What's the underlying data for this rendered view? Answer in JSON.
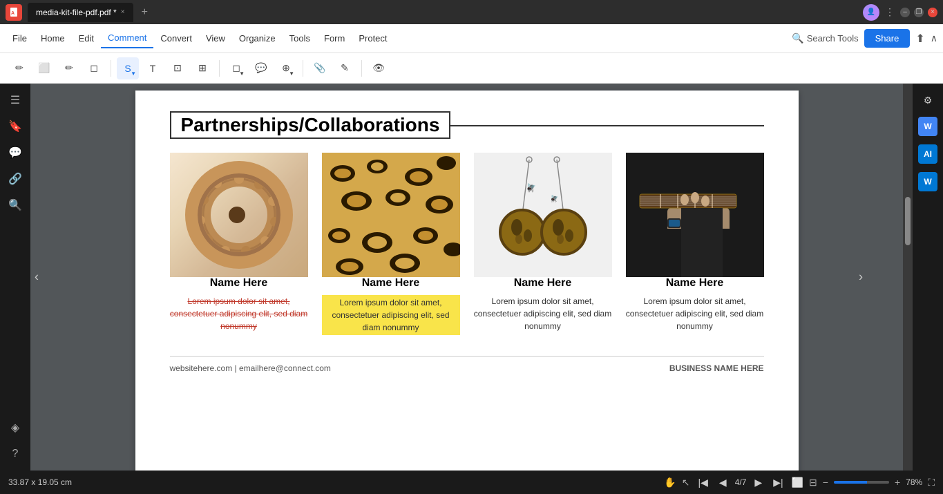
{
  "titlebar": {
    "app_icon": "A",
    "tab_label": "media-kit-file-pdf.pdf *",
    "tab_close": "×",
    "add_tab": "+",
    "window_minimize": "–",
    "window_restore": "❐",
    "window_close": "×"
  },
  "menubar": {
    "file": "File",
    "home": "Home",
    "edit": "Edit",
    "comment": "Comment",
    "convert": "Convert",
    "view": "View",
    "organize": "Organize",
    "tools": "Tools",
    "form": "Form",
    "protect": "Protect",
    "search_tools": "Search Tools",
    "share": "Share"
  },
  "sidebar_left": {
    "icons": [
      "☰",
      "🔖",
      "💬",
      "🔗",
      "🔍",
      "◈"
    ]
  },
  "pdf": {
    "heading": "Partnerships/Collaborations",
    "partners": [
      {
        "name": "Name Here",
        "desc": "Lorem ipsum dolor sit amet, consectetuer adipiscing elit, sed diam nonummy",
        "style": "strikethrough"
      },
      {
        "name": "Name Here",
        "desc": "Lorem ipsum dolor sit amet, consectetuer adipiscing elit, sed diam nonummy",
        "style": "highlighted"
      },
      {
        "name": "Name Here",
        "desc": "Lorem ipsum dolor sit amet, consectetuer adipiscing elit, sed diam nonummy",
        "style": "normal"
      },
      {
        "name": "Name Here",
        "desc": "Lorem ipsum dolor sit amet, consectetuer adipiscing elit, sed diam nonummy",
        "style": "normal"
      }
    ],
    "footer_left": "websitehere.com  |  emailhere@connect.com",
    "footer_right": "BUSINESS NAME HERE",
    "page_current": "4",
    "page_total": "7"
  },
  "bottombar": {
    "dimensions": "33.87 x 19.05 cm",
    "zoom": "78%"
  }
}
